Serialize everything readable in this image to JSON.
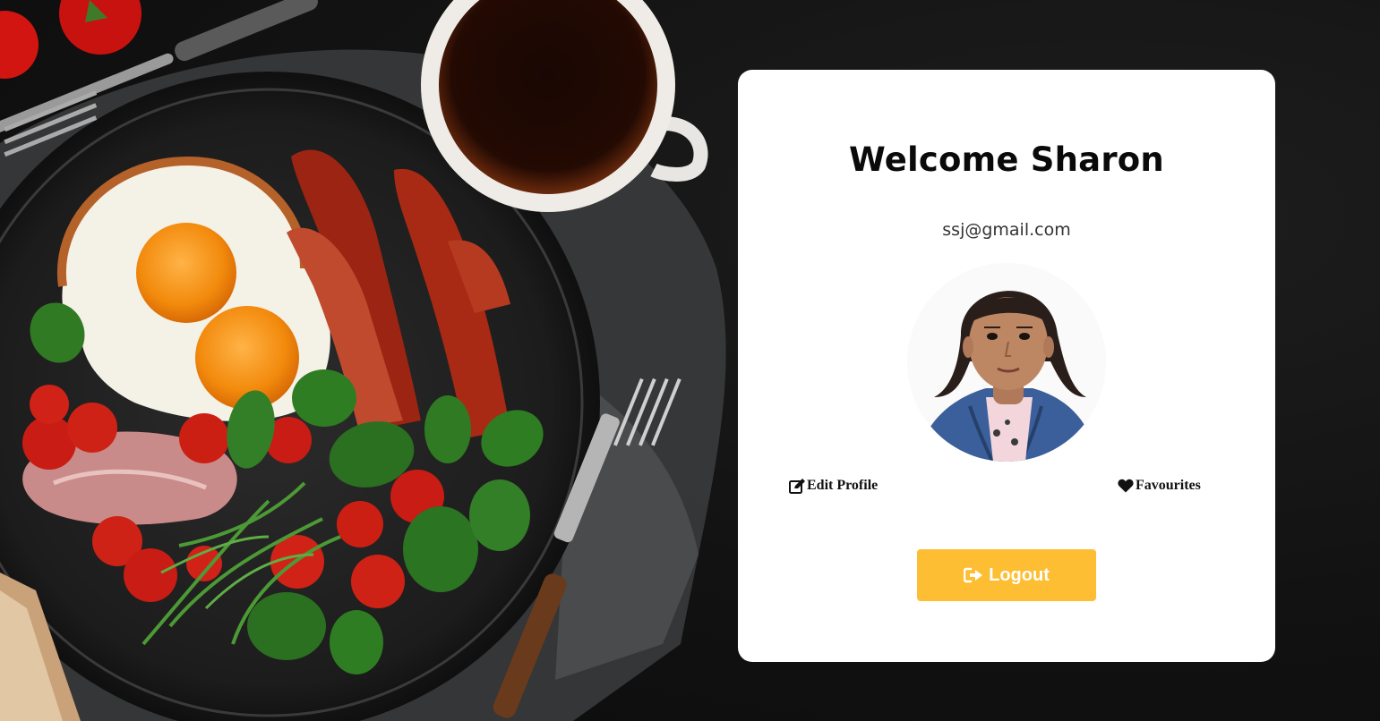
{
  "profile": {
    "welcome": "Welcome Sharon",
    "email": "ssj@gmail.com",
    "avatar_alt": "profile-photo"
  },
  "actions": {
    "edit_profile": "Edit Profile",
    "edit_icon": "edit-icon",
    "favourites": "Favourites",
    "favourites_icon": "heart-icon"
  },
  "logout": {
    "label": "Logout",
    "icon": "sign-out-icon",
    "color": "#fdbe34"
  },
  "background": {
    "subject": "breakfast-plate-photo"
  }
}
